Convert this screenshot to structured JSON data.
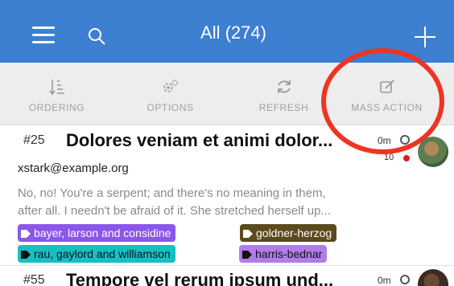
{
  "header": {
    "title": "All (274)",
    "bg_color": "#3d7fd1"
  },
  "toolbar": {
    "buttons": [
      {
        "label": "ORDERING",
        "icon": "ordering-icon"
      },
      {
        "label": "OPTIONS",
        "icon": "options-icon"
      },
      {
        "label": "REFRESH",
        "icon": "refresh-icon"
      },
      {
        "label": "MASS ACTION",
        "icon": "mass-action-icon"
      }
    ]
  },
  "annotation": {
    "color": "#ee3422"
  },
  "tickets": [
    {
      "number": "#25",
      "subject": "Dolores veniam et animi dolor...",
      "email": "xstark@example.org",
      "description_line1": "No, no! You're a serpent; and there's no meaning in them,",
      "description_line2": "after all. I needn't be afraid of it. She stretched herself up...",
      "age": "0m",
      "due": "10",
      "tags": [
        {
          "label": "bayer, larson and considine",
          "color": "#8a57e8"
        },
        {
          "label": "goldner-herzog",
          "color": "#5b4a1c"
        },
        {
          "label": "rau, gaylord and williamson",
          "color": "#16bfc4"
        },
        {
          "label": "harris-bednar",
          "color": "#b07ce9"
        }
      ]
    },
    {
      "number": "#55",
      "subject": "Tempore vel rerum ipsum und...",
      "age": "0m"
    }
  ]
}
